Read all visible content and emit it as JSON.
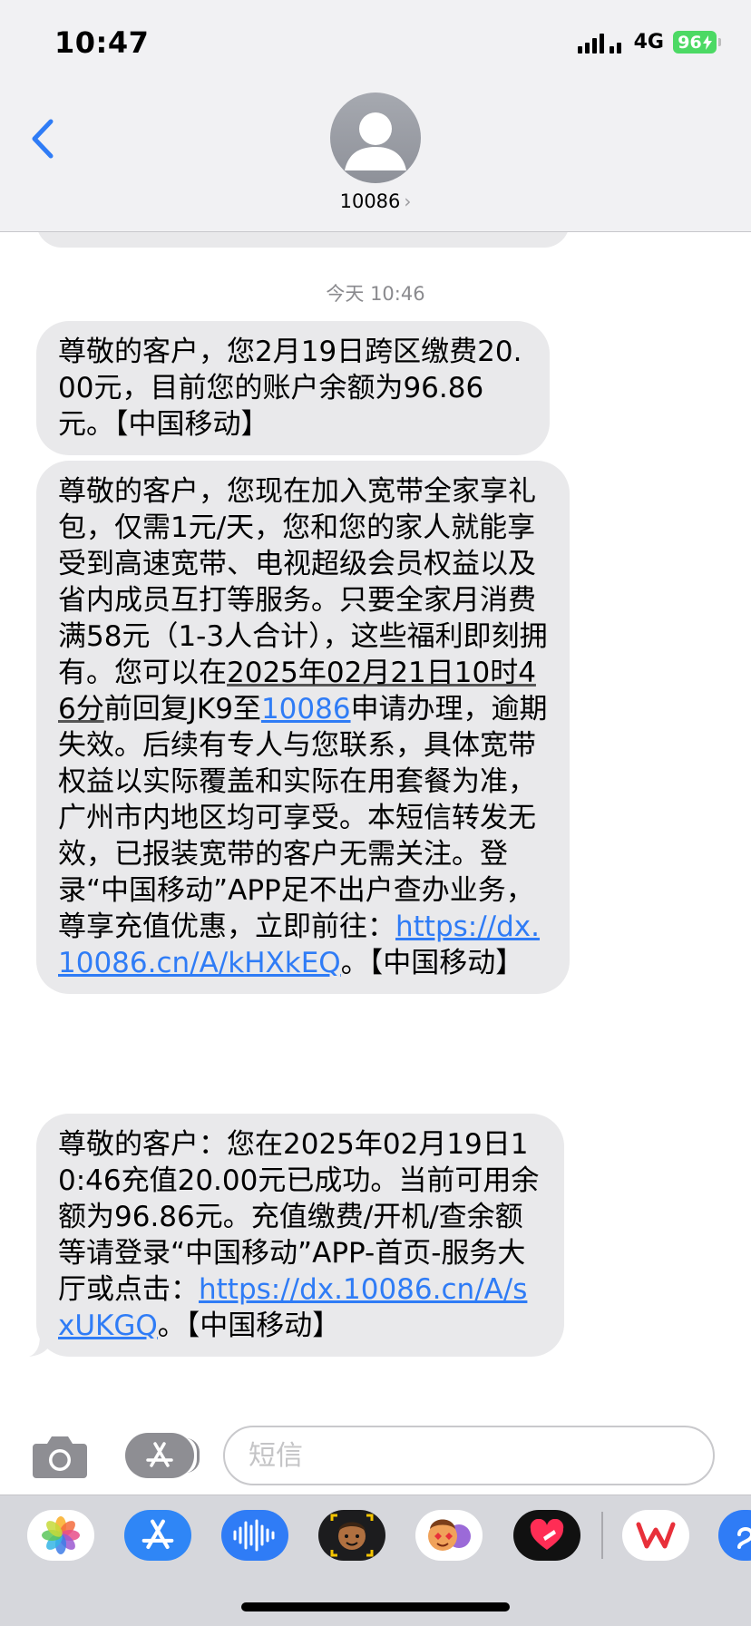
{
  "status_bar": {
    "time": "10:47",
    "network": "4G",
    "battery": "96"
  },
  "header": {
    "contact": "10086",
    "chevron": "›"
  },
  "timestamp": "今天 10:46",
  "messages": [
    {
      "text": "尊敬的客户，您2月19日跨区缴费20.00元，目前您的账户余额为96.86元。【中国移动】"
    },
    {
      "part1": "尊敬的客户，您现在加入宽带全家享礼包，仅需1元/天，您和您的家人就能享受到高速宽带、电视超级会员权益以及省内成员互打等服务。只要全家月消费满58元（1-3人合计），这些福利即刻拥有。您可以在",
      "date_link": "2025年02月21日10时46分",
      "part2": "前回复JK9至",
      "number_link": "10086",
      "part3": "申请办理，逾期失效。后续有专人与您联系，具体宽带权益以实际覆盖和实际在用套餐为准，广州市内地区均可享受。本短信转发无效，已报装宽带的客户无需关注。登录“中国移动”APP足不出户查办业务，尊享充值优惠，立即前往：",
      "url": "https://dx.10086.cn/A/kHXkEQ",
      "part4": "。【中国移动】"
    },
    {
      "part1": "尊敬的客户：您在2025年02月19日10:46充值20.00元已成功。当前可用余额为96.86元。充值缴费/开机/查余额等请登录“中国移动”APP-首页-服务大厅或点击：",
      "url": "https://dx.10086.cn/A/sxUKGQ",
      "part2": "。【中国移动】"
    }
  ],
  "input": {
    "placeholder": "短信"
  },
  "drawer_apps": [
    "photos-icon",
    "app-store-icon",
    "audio-message-icon",
    "memoji-icon",
    "animoji-icon",
    "digital-touch-icon",
    "wps-icon",
    "more-app-icon"
  ],
  "colors": {
    "bubble": "#e9e9eb",
    "link": "#2f7cf6",
    "accent": "#2f7cf6",
    "battery": "#4cd964"
  }
}
